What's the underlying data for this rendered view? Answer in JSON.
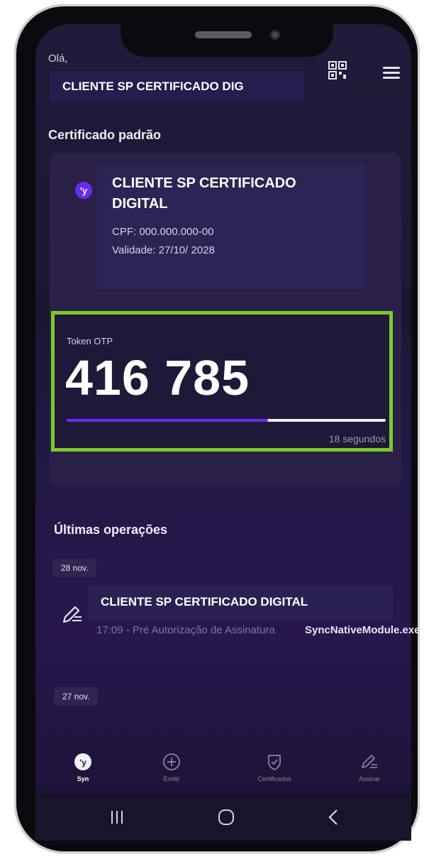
{
  "header": {
    "greeting": "Olá,",
    "client_name": "CLIENTE SP CERTIFICADO DIG",
    "icons": [
      "qr-code-icon",
      "menu-icon"
    ]
  },
  "default_certificate": {
    "section_title": "Certificado padrão",
    "name": "CLIENTE SP CERTIFICADO DIGITAL",
    "cpf": "CPF: 000.000.000-00",
    "validity": "Validade: 27/10/ 2028"
  },
  "token": {
    "label": "Token OTP",
    "code": "416 785",
    "time_remaining": "18 segundos",
    "progress_fraction": 0.63
  },
  "operations": {
    "section_title": "Últimas operações",
    "groups": [
      {
        "date": "28 nov.",
        "items": [
          {
            "name": "CLIENTE SP CERTIFICADO DIGITAL",
            "description": "17:09 - Pré Autorização de Assinatura",
            "app": "SyncNativeModule.exe"
          }
        ]
      },
      {
        "date": "27 nov.",
        "items": []
      }
    ]
  },
  "bottom_nav": {
    "items": [
      {
        "label": "Syn",
        "icon": "syn-logo-icon",
        "active": true
      },
      {
        "label": "Emitir",
        "icon": "plus-circle-icon",
        "active": false
      },
      {
        "label": "Certificados",
        "icon": "shield-check-icon",
        "active": false
      },
      {
        "label": "Assinar",
        "icon": "pen-icon",
        "active": false
      }
    ]
  },
  "colors": {
    "accent": "#6a2df0",
    "highlight_border": "#7cc82a",
    "background": "#1d1533"
  }
}
